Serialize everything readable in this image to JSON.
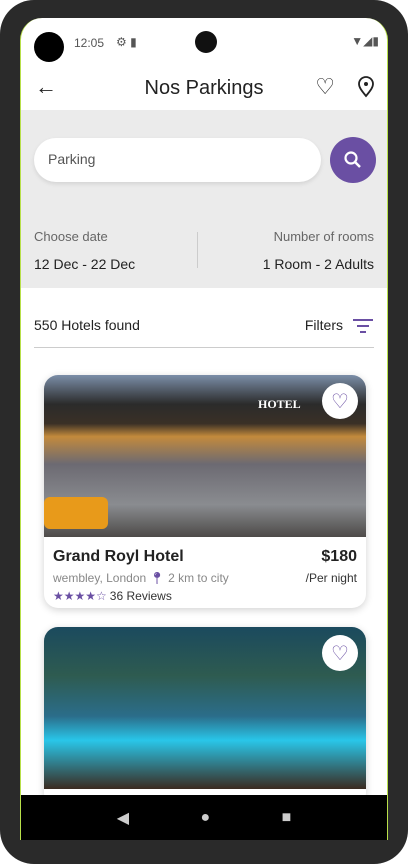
{
  "status": {
    "time": "12:05"
  },
  "appbar": {
    "title": "Nos Parkings"
  },
  "search": {
    "value": "Parking"
  },
  "dates": {
    "label": "Choose date",
    "value": "12 Dec - 22 Dec"
  },
  "rooms": {
    "label": "Number of rooms",
    "value": "1 Room - 2 Adults"
  },
  "results": {
    "count": "550 Hotels found",
    "filters_label": "Filters"
  },
  "hotels": [
    {
      "name": "Grand Royl Hotel",
      "location": "wembley, London",
      "distance": "2 km to city",
      "price": "$180",
      "per": "/Per night",
      "rating": 4,
      "stars": "★★★★☆",
      "reviews": "36 Reviews",
      "sign": "HOTEL"
    }
  ],
  "colors": {
    "accent": "#6a4fa3"
  }
}
